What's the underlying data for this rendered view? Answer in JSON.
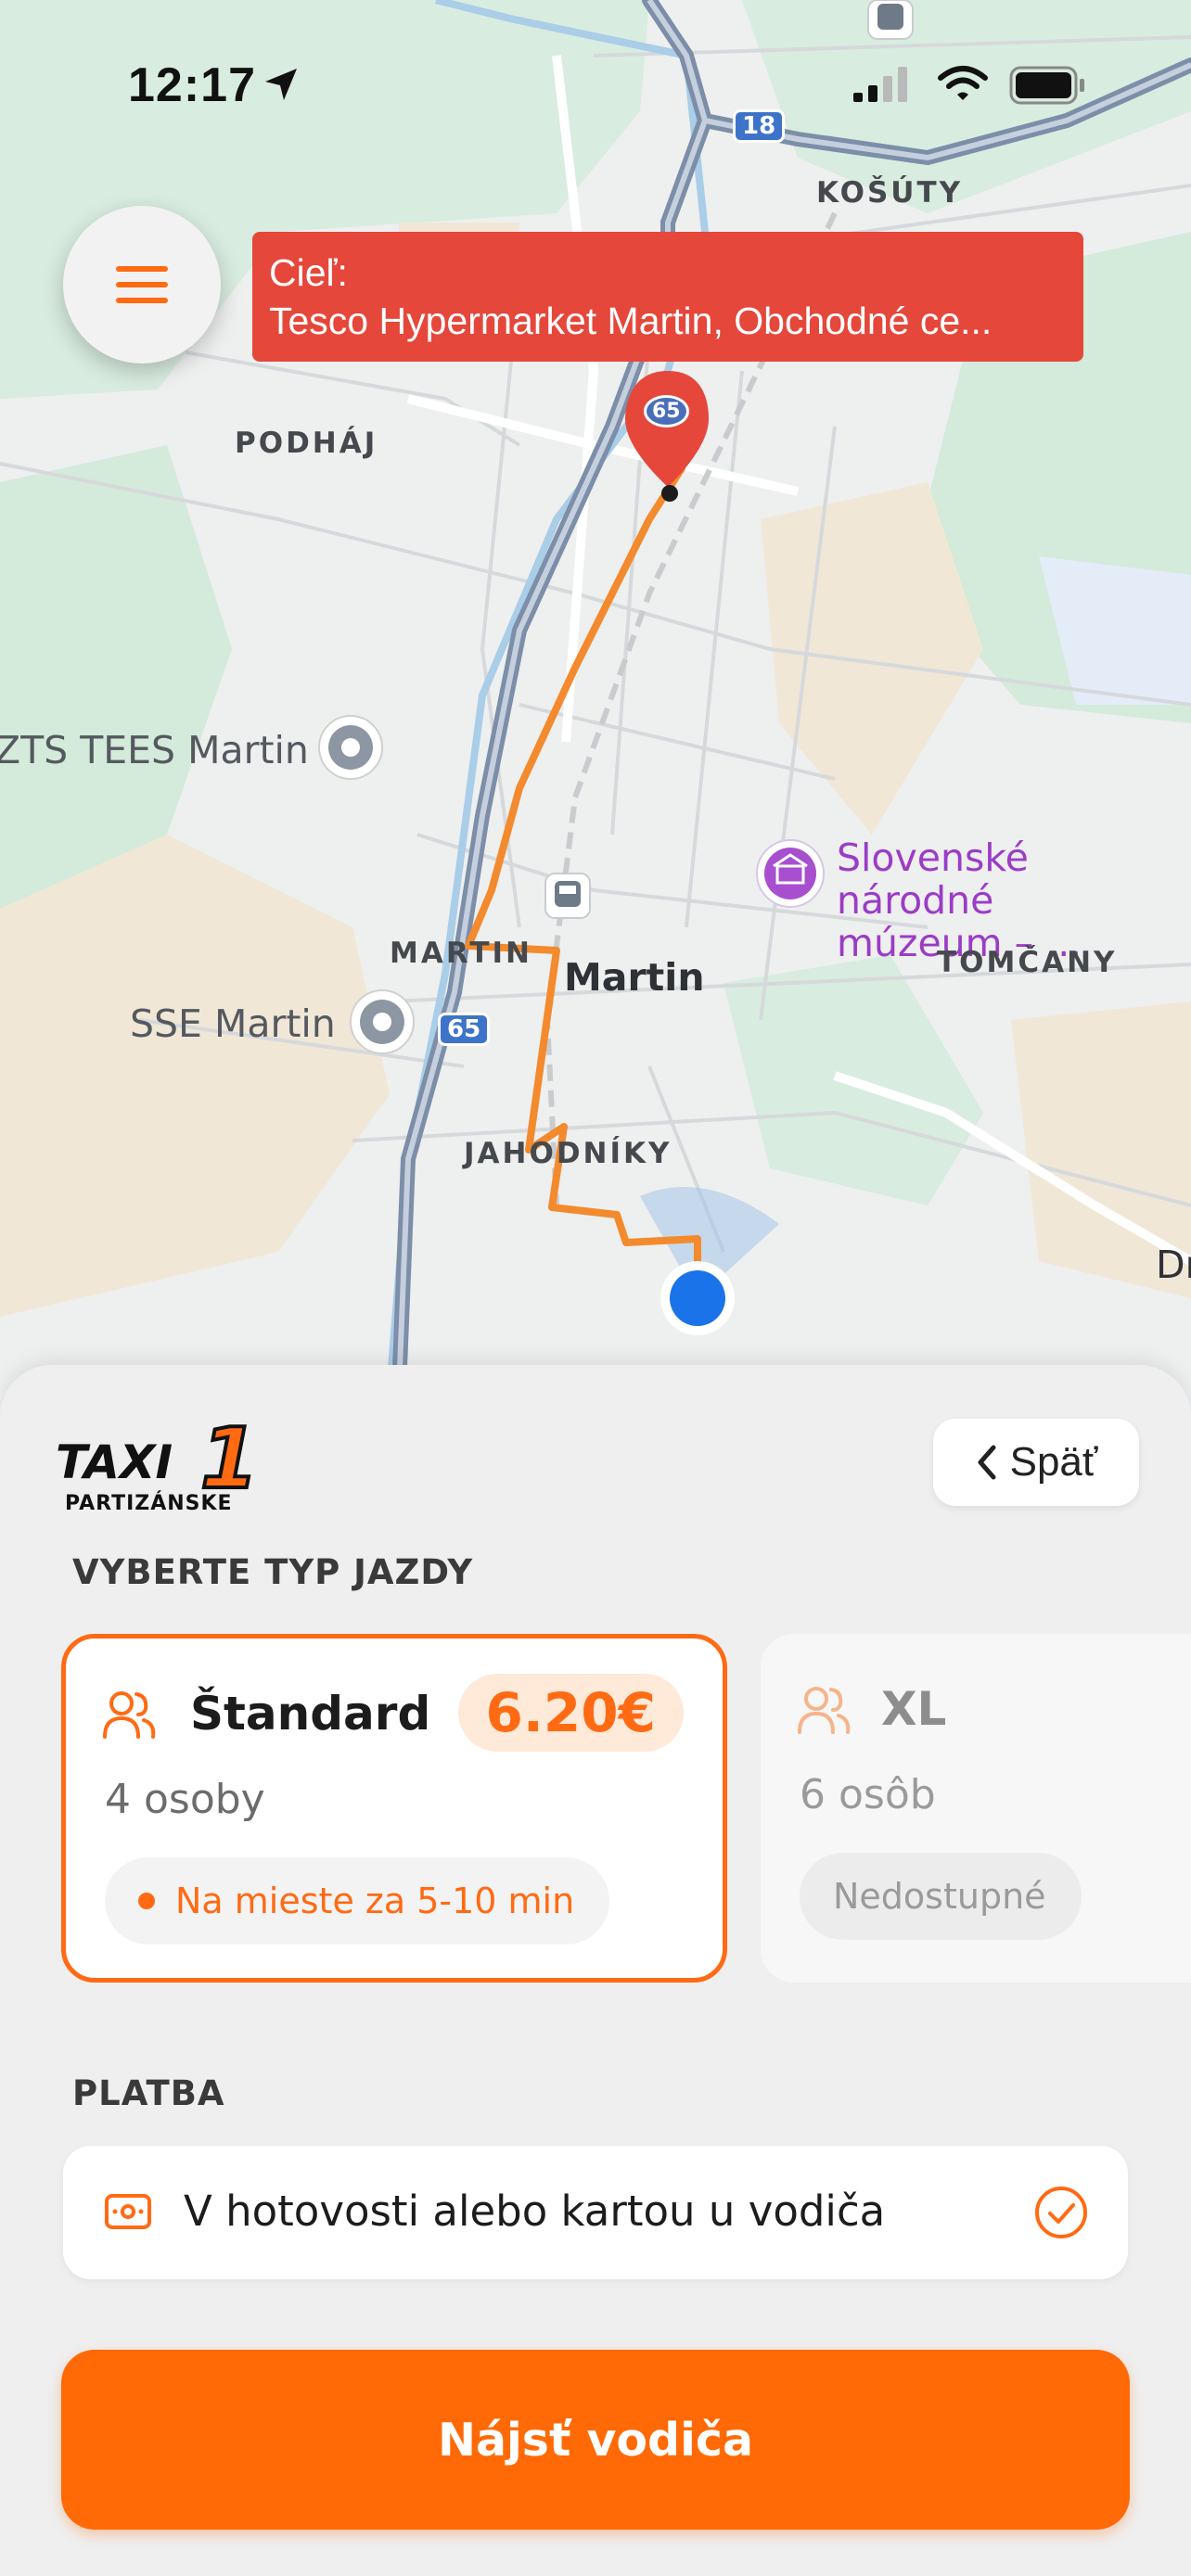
{
  "status_bar": {
    "time": "12:17"
  },
  "destination": {
    "label": "Cieľ:",
    "address": "Tesco Hypermarket Martin, Obchodné ce..."
  },
  "map": {
    "labels": {
      "kosuty": "KOŠÚTY",
      "podhaj": "PODHÁJ",
      "zts": "ZTS TEES Martin",
      "museum_line1": "Slovenské národné",
      "museum_line2": "múzeum – ...",
      "martin_district": "MARTIN",
      "martin_city": "Martin",
      "tomcany": "TOMČANY",
      "sse": "SSE Martin",
      "jahodniky": "JAHODNÍKY",
      "edge": "Dr"
    },
    "road_shields": {
      "r18": "18",
      "r65_top": "65",
      "r65_mid": "65"
    },
    "colors": {
      "route": "#f38a2d",
      "destination_pin": "#e5473b",
      "user_dot": "#1a73e8"
    }
  },
  "sheet": {
    "logo": {
      "brand": "TAXI",
      "number": "1",
      "town": "PARTIZÁNSKE"
    },
    "back_button": {
      "label": "Späť"
    },
    "ride_type_title": "VYBERTE TYP JAZDY",
    "ride_types": [
      {
        "name": "Štandard",
        "price": "6.20€",
        "capacity": "4 osoby",
        "status": "Na mieste za 5-10 min",
        "selected": true
      },
      {
        "name": "XL",
        "capacity": "6 osôb",
        "status": "Nedostupné",
        "selected": false
      }
    ],
    "payment_title": "PLATBA",
    "payment": {
      "method": "V hotovosti alebo kartou u vodiča"
    },
    "find_button": "Nájsť vodiča"
  },
  "colors": {
    "accent": "#ff6a06",
    "accent_light": "#ffe9d9"
  }
}
